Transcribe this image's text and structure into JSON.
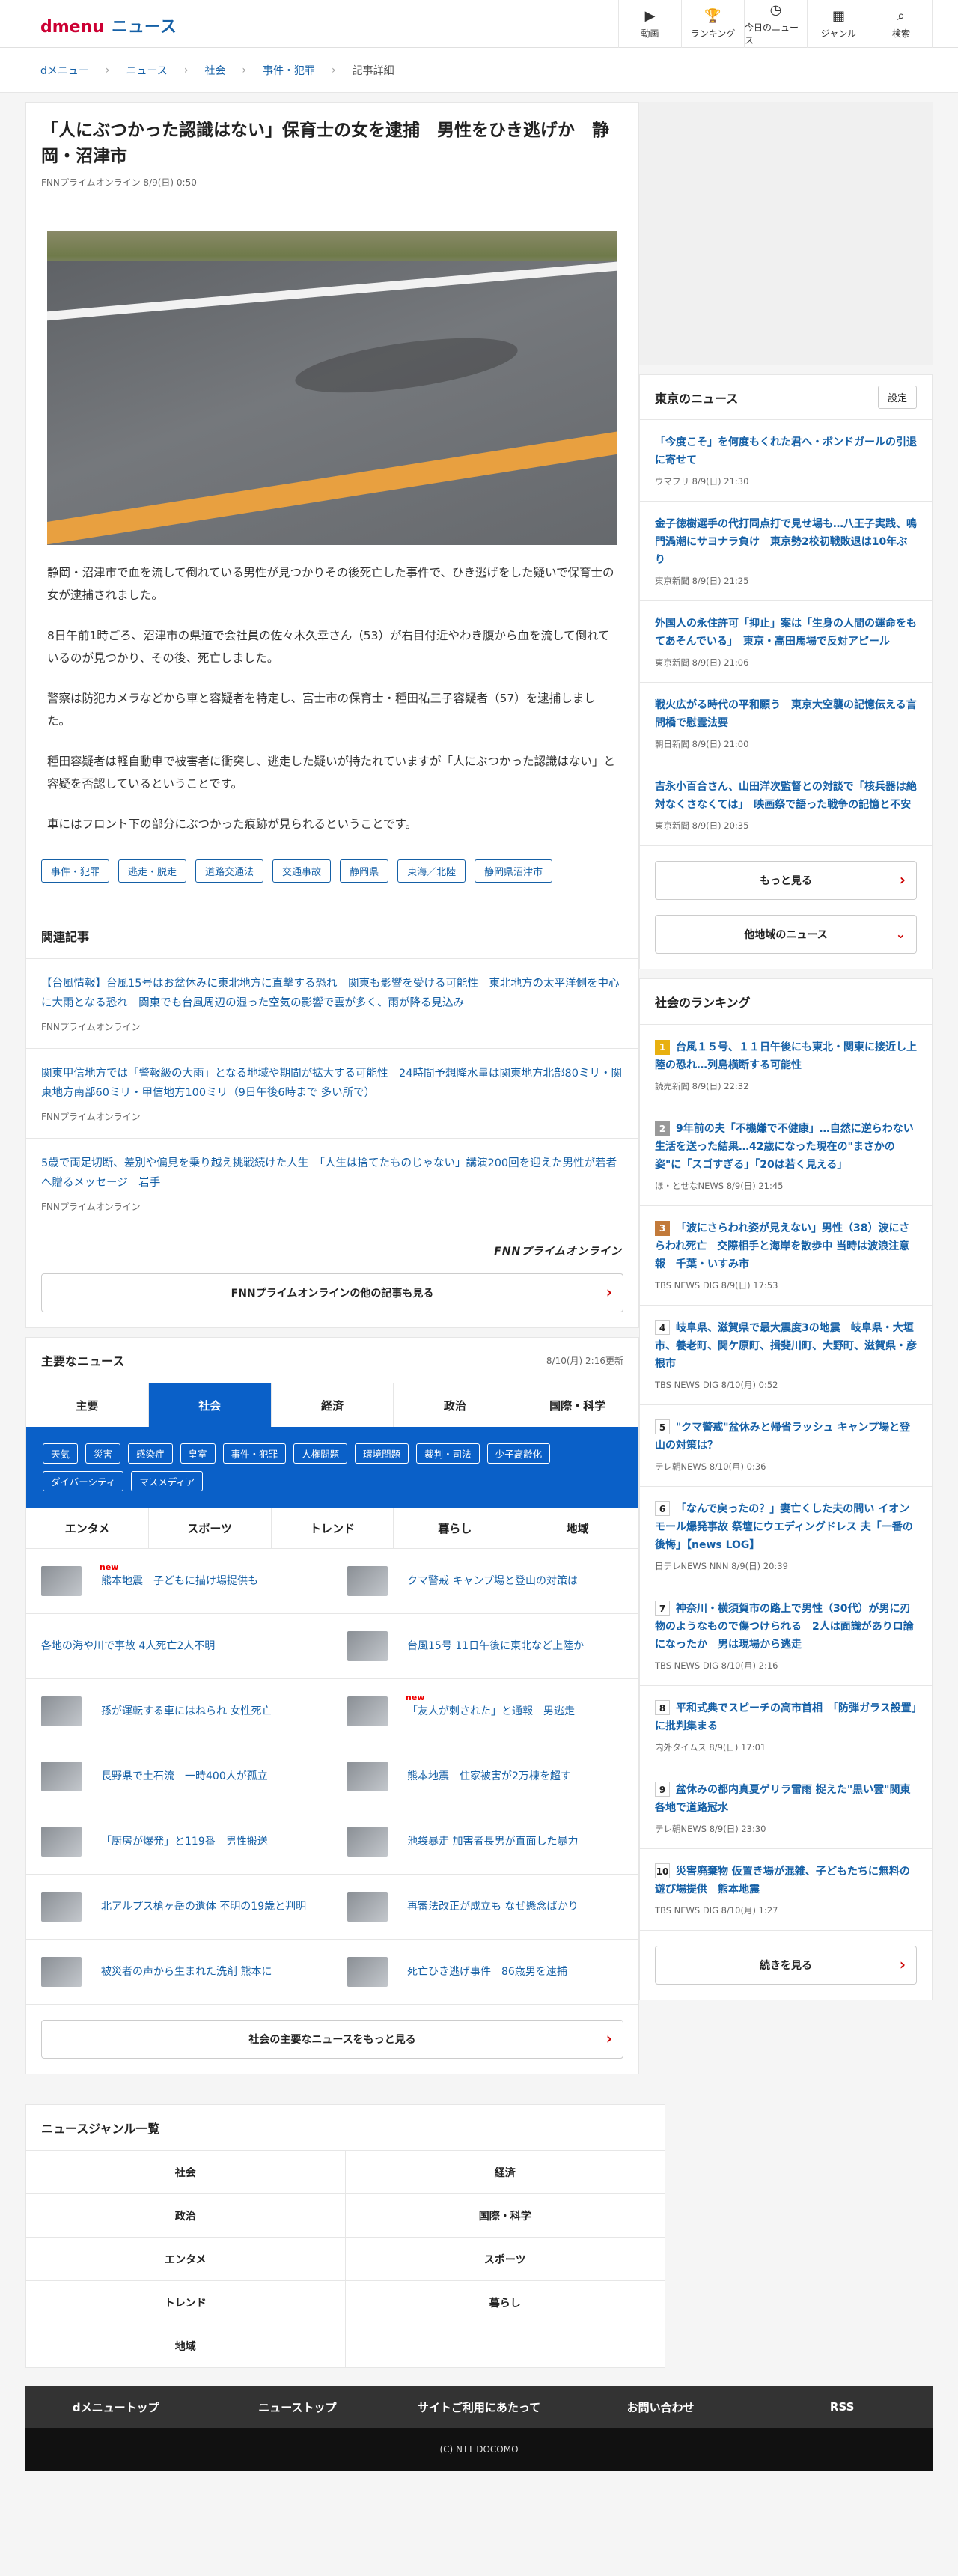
{
  "header": {
    "logo": "dmenu",
    "section": "ニュース",
    "nav": [
      {
        "icon": "▶",
        "label": "動画"
      },
      {
        "icon": "🏆",
        "label": "ランキング"
      },
      {
        "icon": "◷",
        "label": "今日のニュース"
      },
      {
        "icon": "▦",
        "label": "ジャンル"
      },
      {
        "icon": "⌕",
        "label": "検索"
      }
    ]
  },
  "breadcrumb": [
    "dメニュー",
    "ニュース",
    "社会",
    "事件・犯罪",
    "記事詳細"
  ],
  "article": {
    "title": "「人にぶつかった認識はない」保育士の女を逮捕　男性をひき逃げか　静岡・沼津市",
    "meta": "FNNプライムオンライン 8/9(日) 0:50",
    "paragraphs": [
      "静岡・沼津市で血を流して倒れている男性が見つかりその後死亡した事件で、ひき逃げをした疑いで保育士の女が逮捕されました。",
      "8日午前1時ごろ、沼津市の県道で会社員の佐々木久幸さん（53）が右目付近やわき腹から血を流して倒れているのが見つかり、その後、死亡しました。",
      "警察は防犯カメラなどから車と容疑者を特定し、富士市の保育士・種田祐三子容疑者（57）を逮捕しました。",
      "種田容疑者は軽自動車で被害者に衝突し、逃走した疑いが持たれていますが「人にぶつかった認識はない」と容疑を否認しているということです。",
      "車にはフロント下の部分にぶつかった痕跡が見られるということです。"
    ],
    "tags": [
      "事件・犯罪",
      "逃走・脱走",
      "道路交通法",
      "交通事故",
      "静岡県",
      "東海／北陸",
      "静岡県沼津市"
    ]
  },
  "related": {
    "heading": "関連記事",
    "items": [
      {
        "title": "【台風情報】台風15号はお盆休みに東北地方に直撃する恐れ　関東も影響を受ける可能性　東北地方の太平洋側を中心に大雨となる恐れ　関東でも台風周辺の湿った空気の影響で雲が多く、雨が降る見込み",
        "source": "FNNプライムオンライン"
      },
      {
        "title": "関東甲信地方では「警報級の大雨」となる地域や期間が拡大する可能性　24時間予想降水量は関東地方北部80ミリ・関東地方南部60ミリ・甲信地方100ミリ（9日午後6時まで 多い所で）",
        "source": "FNNプライムオンライン"
      },
      {
        "title": "5歳で両足切断、差別や偏見を乗り越え挑戦続けた人生　「人生は捨てたものじゃない」講演200回を迎えた男性が若者へ贈るメッセージ　岩手",
        "source": "FNNプライムオンライン"
      }
    ],
    "provider_logo": "FNNプライムオンライン",
    "more_button": "FNNプライムオンラインの他の記事も見る"
  },
  "major_news": {
    "heading": "主要なニュース",
    "updated": "8/10(月) 2:16更新",
    "tabs": [
      "主要",
      "社会",
      "経済",
      "政治",
      "国際・科学"
    ],
    "active_tab": "社会",
    "subcategories": [
      "天気",
      "災害",
      "感染症",
      "皇室",
      "事件・犯罪",
      "人権問題",
      "環境問題",
      "裁判・司法",
      "少子高齢化",
      "ダイバーシティ",
      "マスメディア"
    ],
    "tabs2": [
      "エンタメ",
      "スポーツ",
      "トレンド",
      "暮らし",
      "地域"
    ],
    "items": [
      {
        "title": "熊本地震　子どもに描け場提供も",
        "new": "new"
      },
      {
        "title": "クマ警戒 キャンプ場と登山の対策は",
        "new": ""
      },
      {
        "title": "各地の海や川で事故 4人死亡2人不明",
        "new": ""
      },
      {
        "title": "台風15号 11日午後に東北など上陸か",
        "new": ""
      },
      {
        "title": "孫が運転する車にはねられ 女性死亡",
        "new": ""
      },
      {
        "title": "「友人が刺された」と通報　男逃走",
        "new": "new"
      },
      {
        "title": "長野県で土石流　一時400人が孤立",
        "new": ""
      },
      {
        "title": "熊本地震　住家被害が2万棟を超す",
        "new": ""
      },
      {
        "title": "「厨房が爆発」と119番　男性搬送",
        "new": ""
      },
      {
        "title": "池袋暴走 加害者長男が直面した暴力",
        "new": ""
      },
      {
        "title": "北アルプス槍ヶ岳の遺体 不明の19歳と判明",
        "new": ""
      },
      {
        "title": "再審法改正が成立も なぜ懸念ばかり",
        "new": ""
      },
      {
        "title": "被災者の声から生まれた洗剤 熊本に",
        "new": ""
      },
      {
        "title": "死亡ひき逃げ事件　86歳男を逮捕",
        "new": ""
      }
    ],
    "more_button": "社会の主要なニュースをもっと見る"
  },
  "genres": {
    "heading": "ニュースジャンル一覧",
    "items": [
      "社会",
      "経済",
      "政治",
      "国際・科学",
      "エンタメ",
      "スポーツ",
      "トレンド",
      "暮らし",
      "地域"
    ]
  },
  "footer": {
    "links": [
      "dメニュートップ",
      "ニューストップ",
      "サイトご利用にあたって",
      "お問い合わせ",
      "RSS"
    ],
    "copyright": "(C) NTT DOCOMO"
  },
  "side_news": {
    "heading": "東京のニュース",
    "setting": "設定",
    "items": [
      {
        "title": "「今度こそ」を何度もくれた君へ・ボンドガールの引退に寄せて",
        "source": "ウマフリ 8/9(日) 21:30"
      },
      {
        "title": "金子徳樹選手の代打同点打で見せ場も…八王子実践、鳴門渦潮にサヨナラ負け　東京勢2校初戦敗退は10年ぶり",
        "source": "東京新聞 8/9(日) 21:25"
      },
      {
        "title": "外国人の永住許可「抑止」案は「生身の人間の運命をもてあそんでいる」　東京・高田馬場で反対アピール",
        "source": "東京新聞 8/9(日) 21:06"
      },
      {
        "title": "戦火広がる時代の平和願う　東京大空襲の記憶伝える言問橋で慰霊法要",
        "source": "朝日新聞 8/9(日) 21:00"
      },
      {
        "title": "吉永小百合さん、山田洋次監督との対談で「核兵器は絶対なくさなくては」　映画祭で語った戦争の記憶と不安",
        "source": "東京新聞 8/9(日) 20:35"
      }
    ],
    "more_button": "もっと見る",
    "other_button": "他地域のニュース"
  },
  "ranking": {
    "heading": "社会のランキング",
    "items": [
      {
        "rank": "1",
        "title": "台風１５号、１１日午後にも東北・関東に接近し上陸の恐れ…列島横断する可能性",
        "source": "読売新聞 8/9(日) 22:32"
      },
      {
        "rank": "2",
        "title": "9年前の夫「不機嫌で不健康」…自然に逆らわない生活を送った結果…42歳になった現在の\"まさかの姿\"に「スゴすぎる」「20は若く見える」",
        "source": "ほ・とせなNEWS 8/9(日) 21:45"
      },
      {
        "rank": "3",
        "title": "「波にさらわれ姿が見えない」男性（38）波にさらわれ死亡　交際相手と海岸を散歩中 当時は波浪注意報　千葉・いすみ市",
        "source": "TBS NEWS DIG 8/9(日) 17:53"
      },
      {
        "rank": "4",
        "title": "岐阜県、滋賀県で最大震度3の地震　岐阜県・大垣市、養老町、関ケ原町、揖斐川町、大野町、滋賀県・彦根市",
        "source": "TBS NEWS DIG 8/10(月) 0:52"
      },
      {
        "rank": "5",
        "title": "\"クマ警戒\"盆休みと帰省ラッシュ キャンプ場と登山の対策は？",
        "source": "テレ朝NEWS 8/10(月) 0:36"
      },
      {
        "rank": "6",
        "title": "「なんで戻ったの？」妻亡くした夫の問い イオンモール爆発事故 祭壇にウエディングドレス 夫「一番の後悔」【news LOG】",
        "source": "日テレNEWS NNN 8/9(日) 20:39"
      },
      {
        "rank": "7",
        "title": "神奈川・横須賀市の路上で男性（30代）が男に刃物のようなもので傷つけられる　2人は面識がありロ論になったか　男は現場から逃走",
        "source": "TBS NEWS DIG 8/10(月) 2:16"
      },
      {
        "rank": "8",
        "title": "平和式典でスピーチの高市首相　「防弾ガラス設置」に批判集まる",
        "source": "内外タイムス 8/9(日) 17:01"
      },
      {
        "rank": "9",
        "title": "盆休みの都内真夏ゲリラ雷雨 捉えた\"黒い雲\"関東各地で道路冠水",
        "source": "テレ朝NEWS 8/9(日) 23:30"
      },
      {
        "rank": "10",
        "title": "災害廃棄物 仮置き場が混雑、子どもたちに無料の遊び場提供　熊本地震",
        "source": "TBS NEWS DIG 8/10(月) 1:27"
      }
    ],
    "more_button": "続きを見る"
  },
  "colors": {
    "brand_red": "#cc0033",
    "link_blue": "#1560a6",
    "active_tab_blue": "#0a60c8"
  }
}
